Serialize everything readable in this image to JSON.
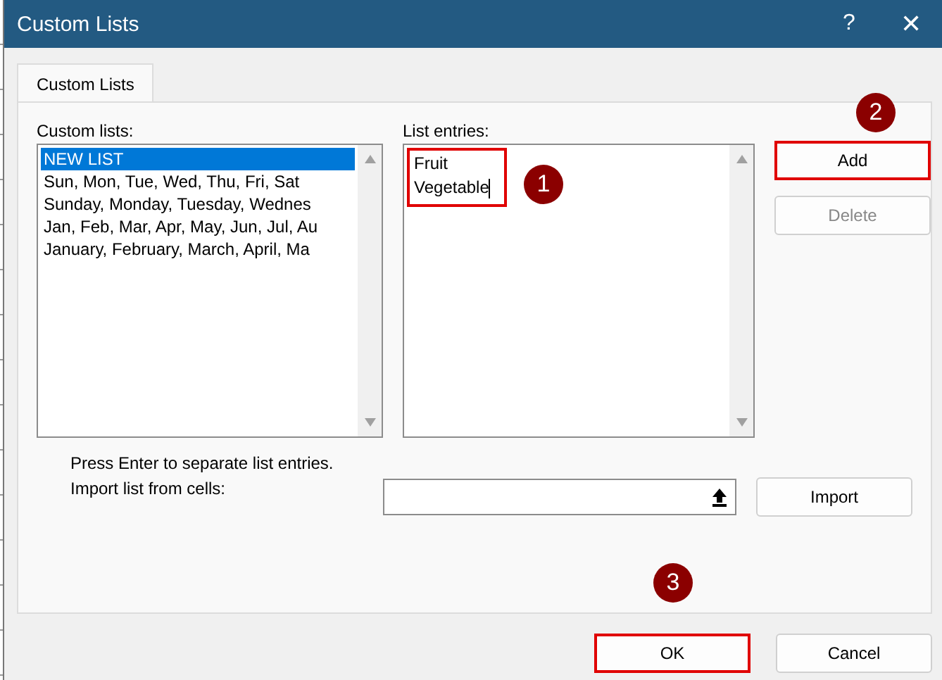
{
  "window": {
    "title": "Custom Lists",
    "help": "?",
    "close": "✕"
  },
  "tabs": [
    {
      "label": "Custom Lists",
      "selected": true
    }
  ],
  "custom_lists": {
    "label": "Custom lists:",
    "items": [
      {
        "text": "NEW LIST",
        "selected": true
      },
      {
        "text": "Sun, Mon, Tue, Wed, Thu, Fri, Sat",
        "selected": false
      },
      {
        "text": "Sunday, Monday, Tuesday, Wednes",
        "selected": false
      },
      {
        "text": "Jan, Feb, Mar, Apr, May, Jun, Jul, Au",
        "selected": false
      },
      {
        "text": "January, February, March, April, Ma",
        "selected": false
      }
    ]
  },
  "list_entries": {
    "label": "List entries:",
    "lines": [
      "Fruit",
      "Vegetable"
    ],
    "highlighted": true,
    "callout": "1"
  },
  "side_buttons": [
    {
      "label": "Add",
      "disabled": false,
      "highlighted": true,
      "callout": "2"
    },
    {
      "label": "Delete",
      "disabled": true,
      "highlighted": false
    }
  ],
  "hint": "Press Enter to separate list entries.",
  "import": {
    "label": "Import list from cells:",
    "button": "Import"
  },
  "footer_buttons": [
    {
      "label": "OK",
      "highlighted": true,
      "callout": "3"
    },
    {
      "label": "Cancel",
      "highlighted": false
    }
  ]
}
